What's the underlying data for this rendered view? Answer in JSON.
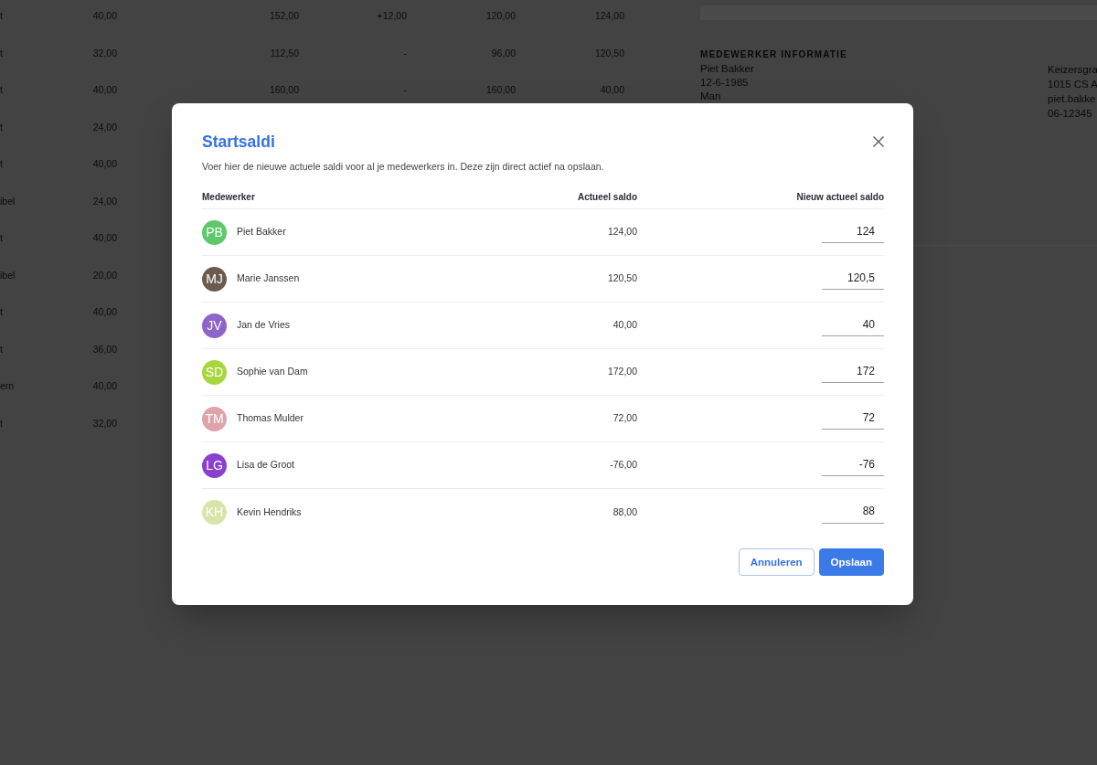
{
  "background": {
    "table_rows": [
      {
        "cells": [
          "t",
          "40,00",
          "152,00",
          "+12,00",
          "120,00",
          "124,00"
        ]
      },
      {
        "cells": [
          "t",
          "32,00",
          "112,50",
          "-",
          "96,00",
          "120,50"
        ]
      },
      {
        "cells": [
          "t",
          "40,00",
          "160,00",
          "-",
          "160,00",
          "40,00"
        ]
      },
      {
        "cells": [
          "t",
          "24,00"
        ]
      },
      {
        "cells": [
          "t",
          "40,00"
        ]
      },
      {
        "cells": [
          "ibel",
          "24,00"
        ]
      },
      {
        "cells": [
          "t",
          "40,00"
        ]
      },
      {
        "cells": [
          "ibel",
          "20,00"
        ]
      },
      {
        "cells": [
          "t",
          "40,00"
        ]
      },
      {
        "cells": [
          "t",
          "36,00"
        ]
      },
      {
        "cells": [
          "ern",
          "40,00"
        ]
      },
      {
        "cells": [
          "t",
          "32,00"
        ]
      }
    ],
    "info_panel": {
      "heading": "MEDEWERKER INFORMATIE",
      "column_1": [
        "Piet Bakker",
        "12-6-1985",
        "Man"
      ],
      "column_2": [
        "Keizersgra",
        "1015 CS A",
        "piet.bakke",
        "06-12345"
      ]
    }
  },
  "dialog": {
    "title": "Startsaldi",
    "description": "Voer hier de nieuwe actuele saldi voor al je medewerkers in. Deze zijn direct actief na opslaan.",
    "columns": [
      "Medewerker",
      "Actueel saldo",
      "Nieuw actueel saldo"
    ],
    "rows": [
      {
        "initials": "PB",
        "name": "Piet Bakker",
        "color": "#5ec86b",
        "current": "124,00",
        "new_value": "124"
      },
      {
        "initials": "MJ",
        "name": "Marie Janssen",
        "color": "#6b5a50",
        "current": "120,50",
        "new_value": "120,5"
      },
      {
        "initials": "JV",
        "name": "Jan de Vries",
        "color": "#8e64c8",
        "current": "40,00",
        "new_value": "40"
      },
      {
        "initials": "SD",
        "name": "Sophie van Dam",
        "color": "#a9d63c",
        "current": "172,00",
        "new_value": "172"
      },
      {
        "initials": "TM",
        "name": "Thomas Mulder",
        "color": "#e0a3aa",
        "current": "72,00",
        "new_value": "72"
      },
      {
        "initials": "LG",
        "name": "Lisa de Groot",
        "color": "#8a40cf",
        "current": "-76,00",
        "new_value": "-76"
      },
      {
        "initials": "KH",
        "name": "Kevin Hendriks",
        "color": "#d8e4aa",
        "current": "88,00",
        "new_value": "88"
      }
    ],
    "buttons": [
      {
        "label": "Annuleren",
        "kind": "secondary"
      },
      {
        "label": "Opslaan",
        "kind": "primary"
      }
    ]
  }
}
